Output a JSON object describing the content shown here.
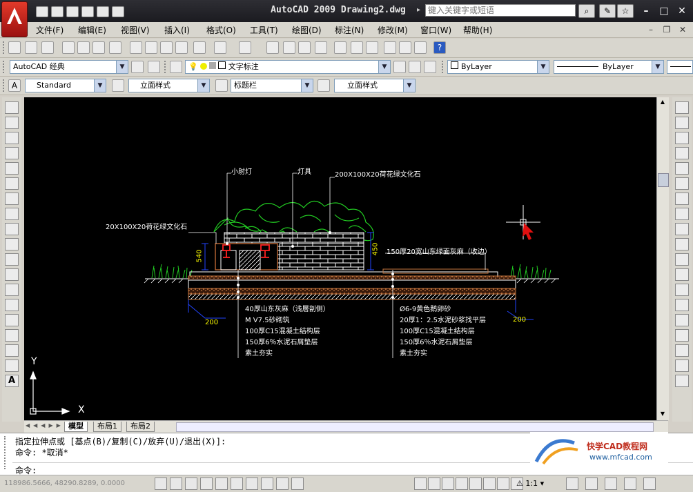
{
  "window": {
    "title": "AutoCAD 2009 Drawing2.dwg",
    "search_placeholder": "键入关键字或短语"
  },
  "menu": [
    "文件(F)",
    "编辑(E)",
    "视图(V)",
    "插入(I)",
    "格式(O)",
    "工具(T)",
    "绘图(D)",
    "标注(N)",
    "修改(M)",
    "窗口(W)",
    "帮助(H)"
  ],
  "toolbar2": {
    "workspace": "AutoCAD 经典",
    "layer": "文字标注",
    "color": "ByLayer",
    "linetype": "ByLayer"
  },
  "toolbar3": {
    "text_style": "Standard",
    "dim_style": "立面样式",
    "table_style": "标题栏",
    "mleader_style": "立面样式"
  },
  "drawing": {
    "labels": {
      "lamp": "小射灯",
      "fixture": "灯具",
      "stone_top": "200X100X20荷花绿文化石",
      "stone_left": "20X100X20荷花绿文化石",
      "coping": "150厚20宽山东绿面灰麻（收边）",
      "dim_540": "540",
      "dim_450": "450",
      "dim_200_left": "200",
      "dim_200_right": "200"
    },
    "notes_left": [
      "40厚山东灰麻（浅層剖侧）",
      "M V7.5砂砌筑",
      "100厚C15混凝土结构层",
      "150厚6％水泥石屑垫层",
      "素土夯实"
    ],
    "notes_right": [
      "Ø6-9黄色鹅卵砂",
      "20厚1：2.5水泥砂浆找平层",
      "100厚C15混凝土结构层",
      "150厚6％水泥石屑垫层",
      "素土夯实"
    ],
    "ucs_x": "X",
    "ucs_y": "Y"
  },
  "layout_tabs": [
    "模型",
    "布局1",
    "布局2"
  ],
  "command": {
    "line1": "指定拉伸点或 [基点(B)/复制(C)/放弃(U)/退出(X)]:",
    "line2": "命令: *取消*",
    "prompt": "命令:"
  },
  "status": {
    "coordinates": "118986.5666, 48290.8289, 0.0000",
    "scale": "1:1"
  },
  "watermark": {
    "title": "快学CAD教程网",
    "url": "www.mfcad.com"
  },
  "colors": {
    "canvas": "#000000",
    "plant": "#22cc22",
    "lamp": "#ff2222",
    "dimension": "#2244ff",
    "dimension_text": "#ffff00",
    "wall": "#ffffff",
    "soil": "#b06030"
  }
}
